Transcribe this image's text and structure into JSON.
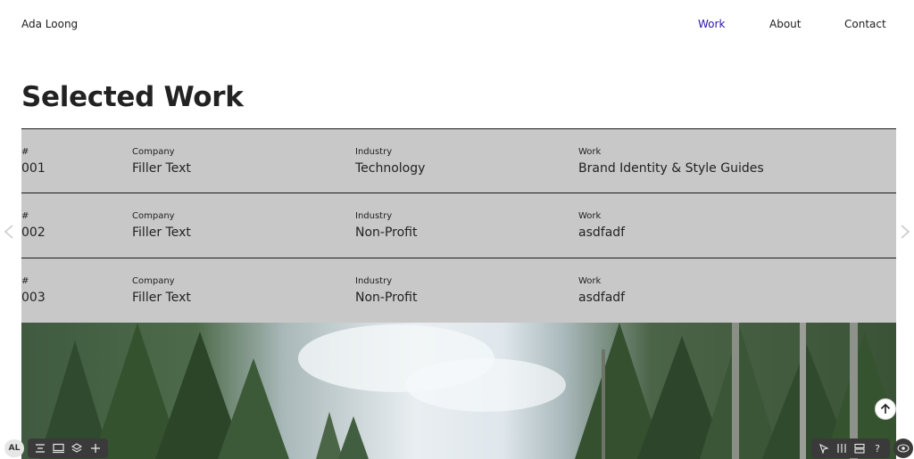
{
  "site": {
    "name": "Ada Loong"
  },
  "nav": {
    "items": [
      {
        "label": "Work",
        "active": true
      },
      {
        "label": "About",
        "active": false
      },
      {
        "label": "Contact",
        "active": false
      }
    ],
    "active_color": "#2a15a8"
  },
  "page": {
    "heading": "Selected Work"
  },
  "table": {
    "labels": {
      "number": "#",
      "company": "Company",
      "industry": "Industry",
      "work": "Work"
    },
    "rows": [
      {
        "number": "001",
        "company": "Filler Text",
        "industry": "Technology",
        "work": "Brand Identity & Style Guides"
      },
      {
        "number": "002",
        "company": "Filler Text",
        "industry": "Non-Profit",
        "work": "asdfadf"
      },
      {
        "number": "003",
        "company": "Filler Text",
        "industry": "Non-Profit",
        "work": "asdfadf"
      }
    ],
    "row_background": "#c8c8c8"
  },
  "carousel": {
    "prev_icon": "chevron-left-icon",
    "next_icon": "chevron-right-icon"
  },
  "editor": {
    "avatar_initials": "AL",
    "left_tools": [
      "text-icon",
      "desktop-icon",
      "layers-icon",
      "plus-icon"
    ],
    "right_tools": [
      "select-icon",
      "columns-icon",
      "rows-icon",
      "help-icon"
    ],
    "help_glyph": "?",
    "preview_icon": "eye-icon"
  }
}
